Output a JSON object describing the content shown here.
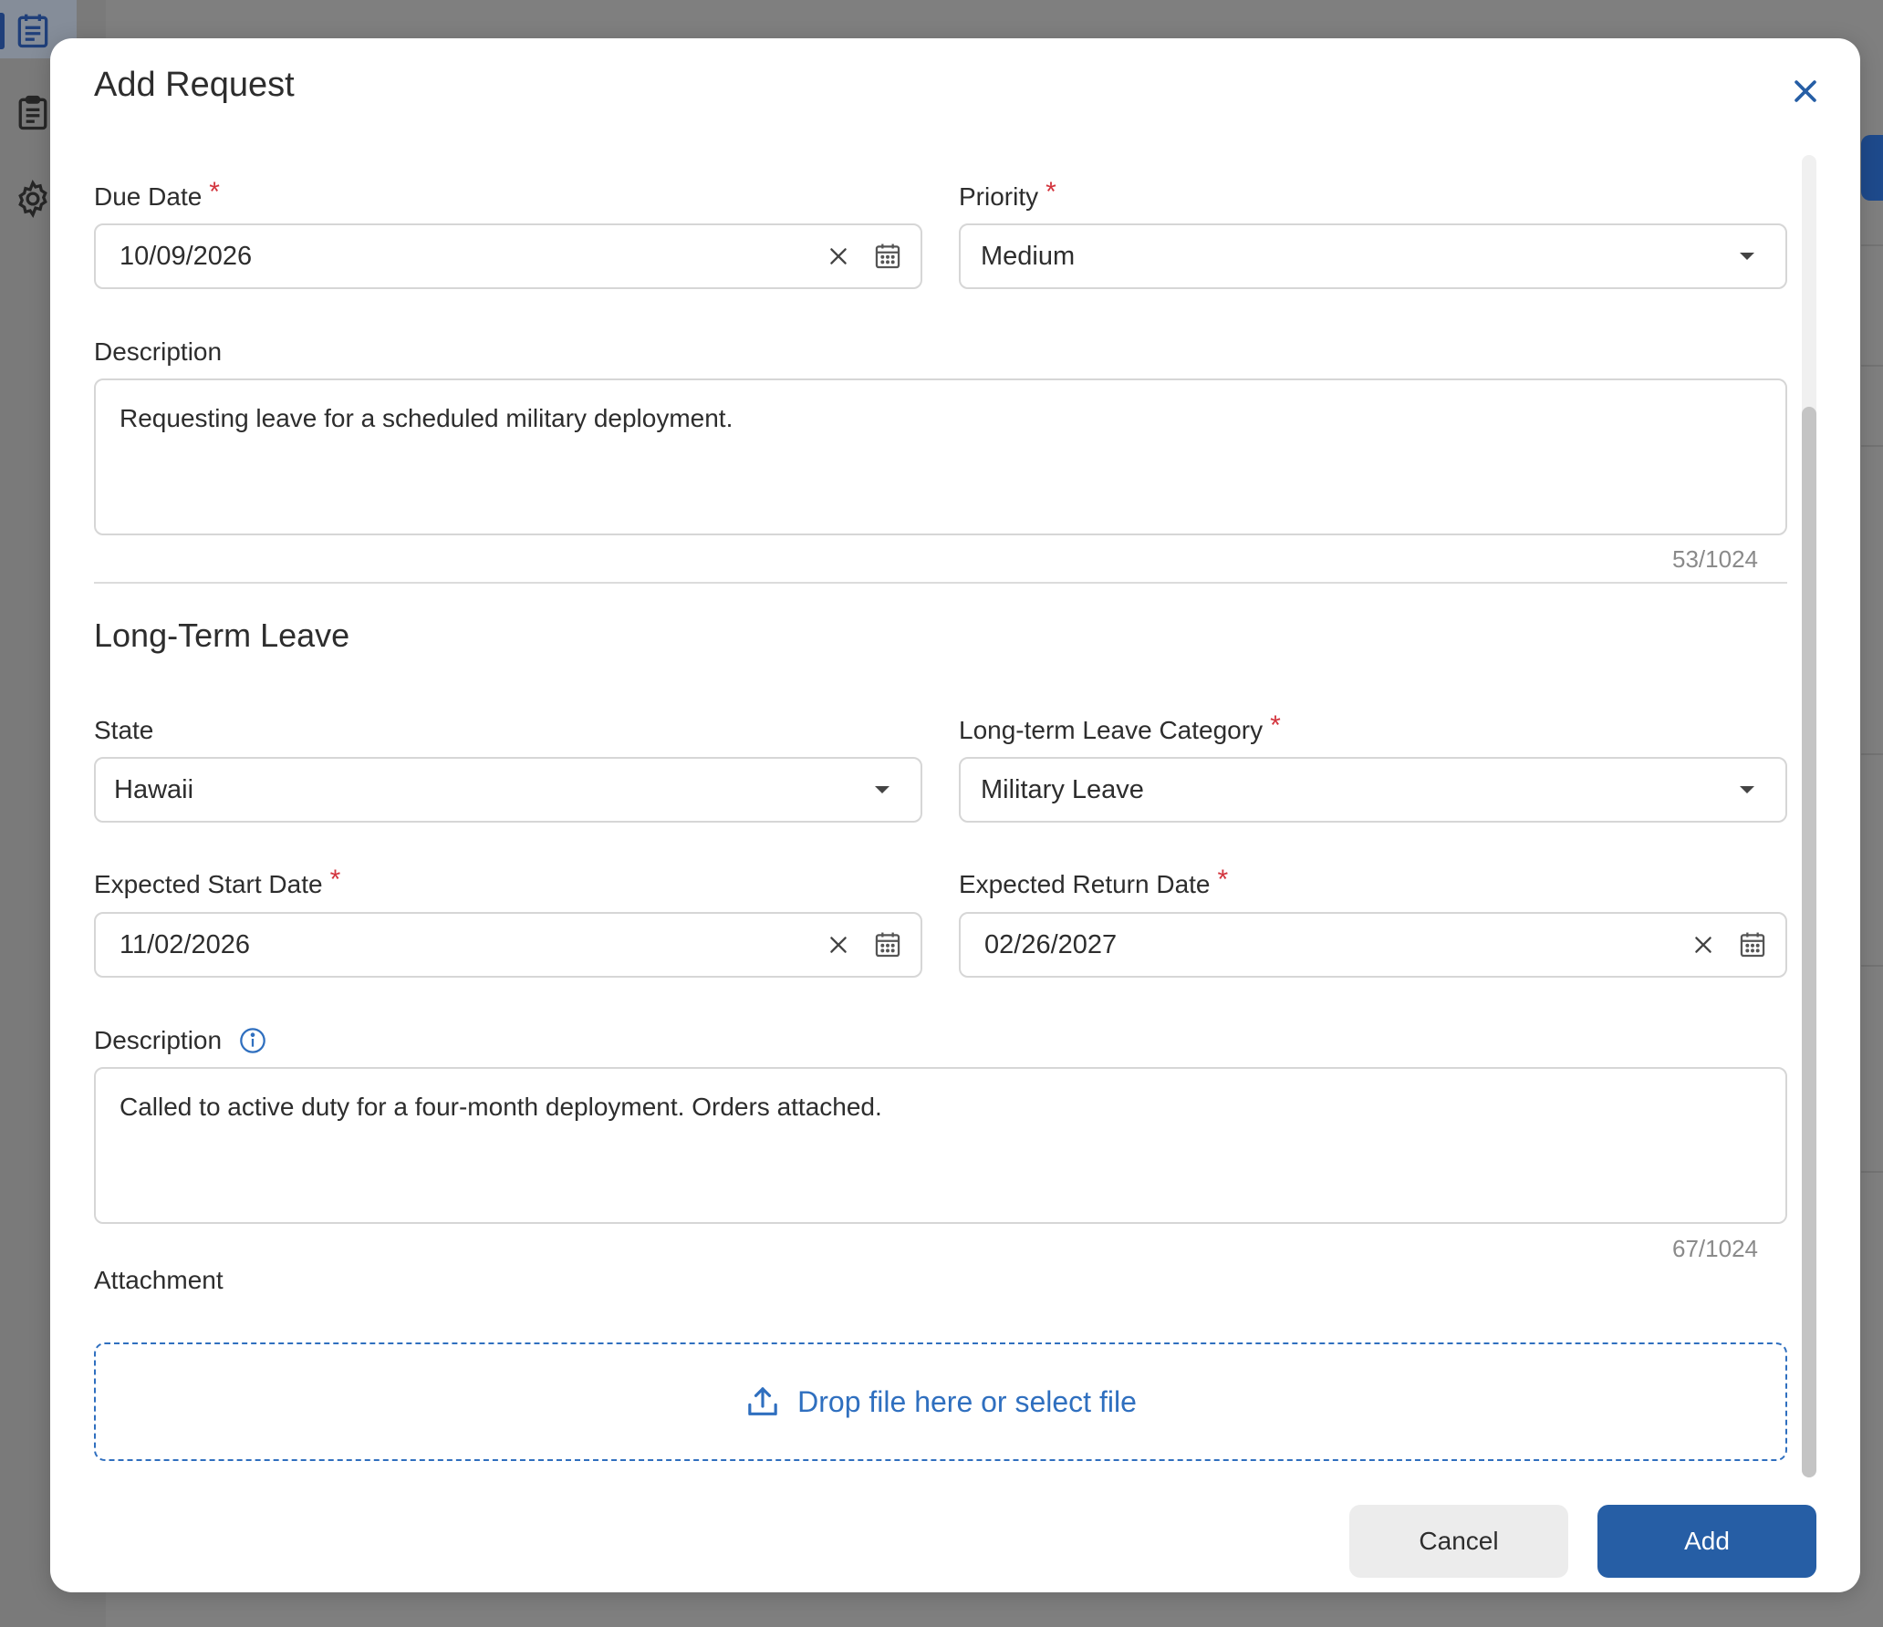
{
  "modal": {
    "title": "Add Request",
    "due_date": {
      "label": "Due Date",
      "value": "10/09/2026",
      "required": true
    },
    "priority": {
      "label": "Priority",
      "value": "Medium",
      "required": true
    },
    "description": {
      "label": "Description",
      "value": "Requesting leave for a scheduled military deployment.",
      "counter": "53/1024"
    },
    "section_title": "Long-Term Leave",
    "state": {
      "label": "State",
      "value": "Hawaii"
    },
    "leave_category": {
      "label": "Long-term Leave Category",
      "value": "Military Leave",
      "required": true
    },
    "expected_start": {
      "label": "Expected Start Date",
      "value": "11/02/2026",
      "required": true
    },
    "expected_return": {
      "label": "Expected Return Date",
      "value": "02/26/2027",
      "required": true
    },
    "leave_description": {
      "label": "Description",
      "value": "Called to active duty for a four-month deployment. Orders attached.",
      "counter": "67/1024"
    },
    "attachment": {
      "label": "Attachment",
      "dropzone_text": "Drop file here or select file"
    },
    "buttons": {
      "cancel": "Cancel",
      "add": "Add"
    }
  },
  "required_marker": "*",
  "icons": {
    "close": "close-icon",
    "clear": "clear-icon",
    "calendar": "calendar-icon",
    "dropdown": "chevron-down-icon",
    "info": "info-icon",
    "upload": "upload-icon"
  },
  "colors": {
    "accent": "#265ea5",
    "link": "#2f6fbf",
    "required": "#d3343d",
    "overlay": "#7f7f7f"
  }
}
